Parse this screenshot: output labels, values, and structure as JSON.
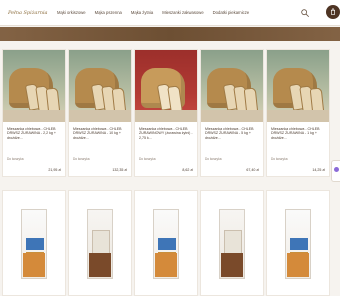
{
  "brand": {
    "logo_text": "Pełna Spiżarnia"
  },
  "nav": [
    {
      "label": "Mąki orkiszowe"
    },
    {
      "label": "Mąka pszenna"
    },
    {
      "label": "Mąka żytnia"
    },
    {
      "label": "Mieszanki zakwasowe"
    },
    {
      "label": "Dodatki piekarnicze"
    }
  ],
  "products_top": [
    {
      "title": "Mieszanka chlebowa - CHLEB DRWSZ ŻURAWINA - 2,2 kg + drożdże...",
      "tag": "Do koszyka",
      "price": "21,95 zł"
    },
    {
      "title": "Mieszanka chlebowa - CHLEB DRWSZ ŻURAWINA - 10 kg + drożdże...",
      "tag": "Do koszyka",
      "price": "132,35 zł"
    },
    {
      "title": "Mieszanka chlebowa - CHLEB ŻURAWINOWY (żurawina żytni) - 2,75 k...",
      "tag": "Do koszyka",
      "price": "8,62 zł"
    },
    {
      "title": "Mieszanka chlebowa - CHLEB DRWSZ ŻURAWINA - 5 kg + drożdże...",
      "tag": "Do koszyka",
      "price": "67,40 zł"
    },
    {
      "title": "Mieszanka chlebowa - CHLEB DRWSZ ŻURAWINA - 1 kg + drożdże...",
      "tag": "Do koszyka",
      "price": "14,25 zł"
    }
  ]
}
